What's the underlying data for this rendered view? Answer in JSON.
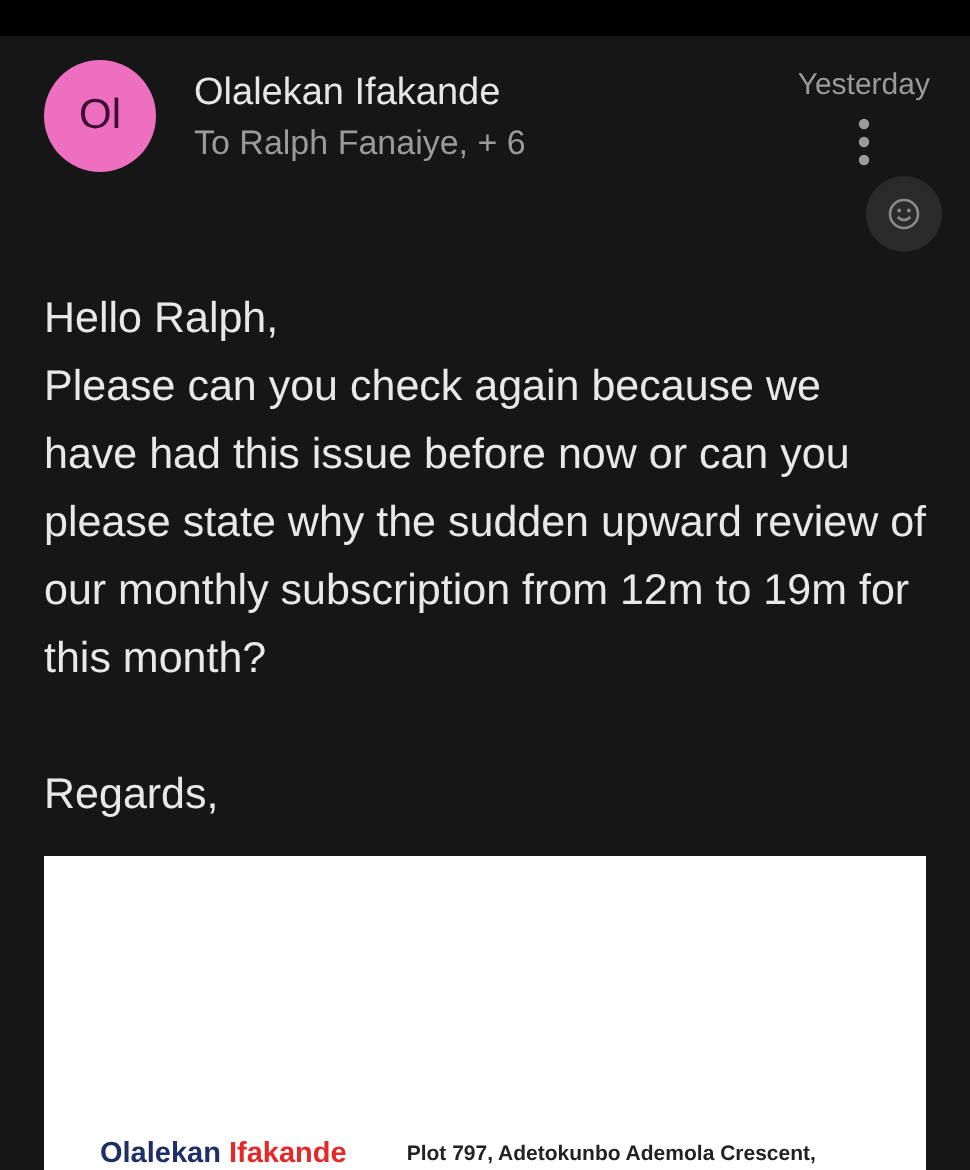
{
  "message": {
    "sender": "Olalekan Ifakande",
    "initials": "Ol",
    "recipients": "To Ralph Fanaiye, + 6",
    "time": "Yesterday",
    "greeting": "Hello Ralph,",
    "body": "Please can you check again because we have had this issue before now or can you please state why the sudden upward review of our monthly subscription from 12m to 19m for this month?",
    "closing": "Regards,",
    "signature": {
      "name_first": "Olalekan",
      "name_second": "Ifakande",
      "address": "Plot 797, Adetokunbo Ademola Crescent,"
    }
  }
}
